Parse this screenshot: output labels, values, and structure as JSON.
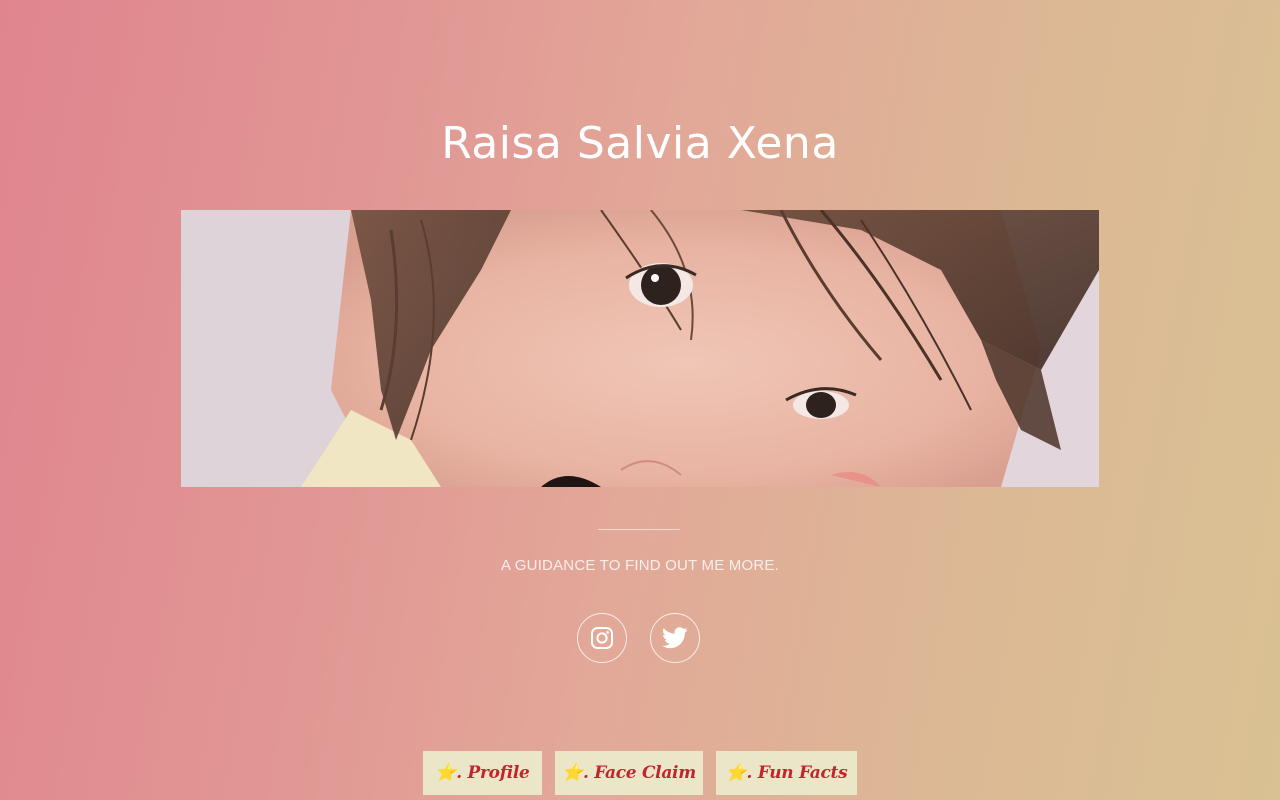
{
  "profile": {
    "name": "Raisa Salvia Xena",
    "tagline": "A GUIDANCE TO FIND OUT ME MORE."
  },
  "hero": {
    "alt": "portrait photo"
  },
  "social": [
    {
      "icon": "instagram-icon"
    },
    {
      "icon": "twitter-icon"
    }
  ],
  "nav": [
    {
      "label": "⭐. Profile"
    },
    {
      "label": "⭐. Face Claim"
    },
    {
      "label": "⭐. Fun Facts"
    }
  ],
  "colors": {
    "button_bg": "#ece6c9",
    "button_text": "#c0262c",
    "gradient_left": "#e0858e",
    "gradient_right": "#d9c193"
  }
}
